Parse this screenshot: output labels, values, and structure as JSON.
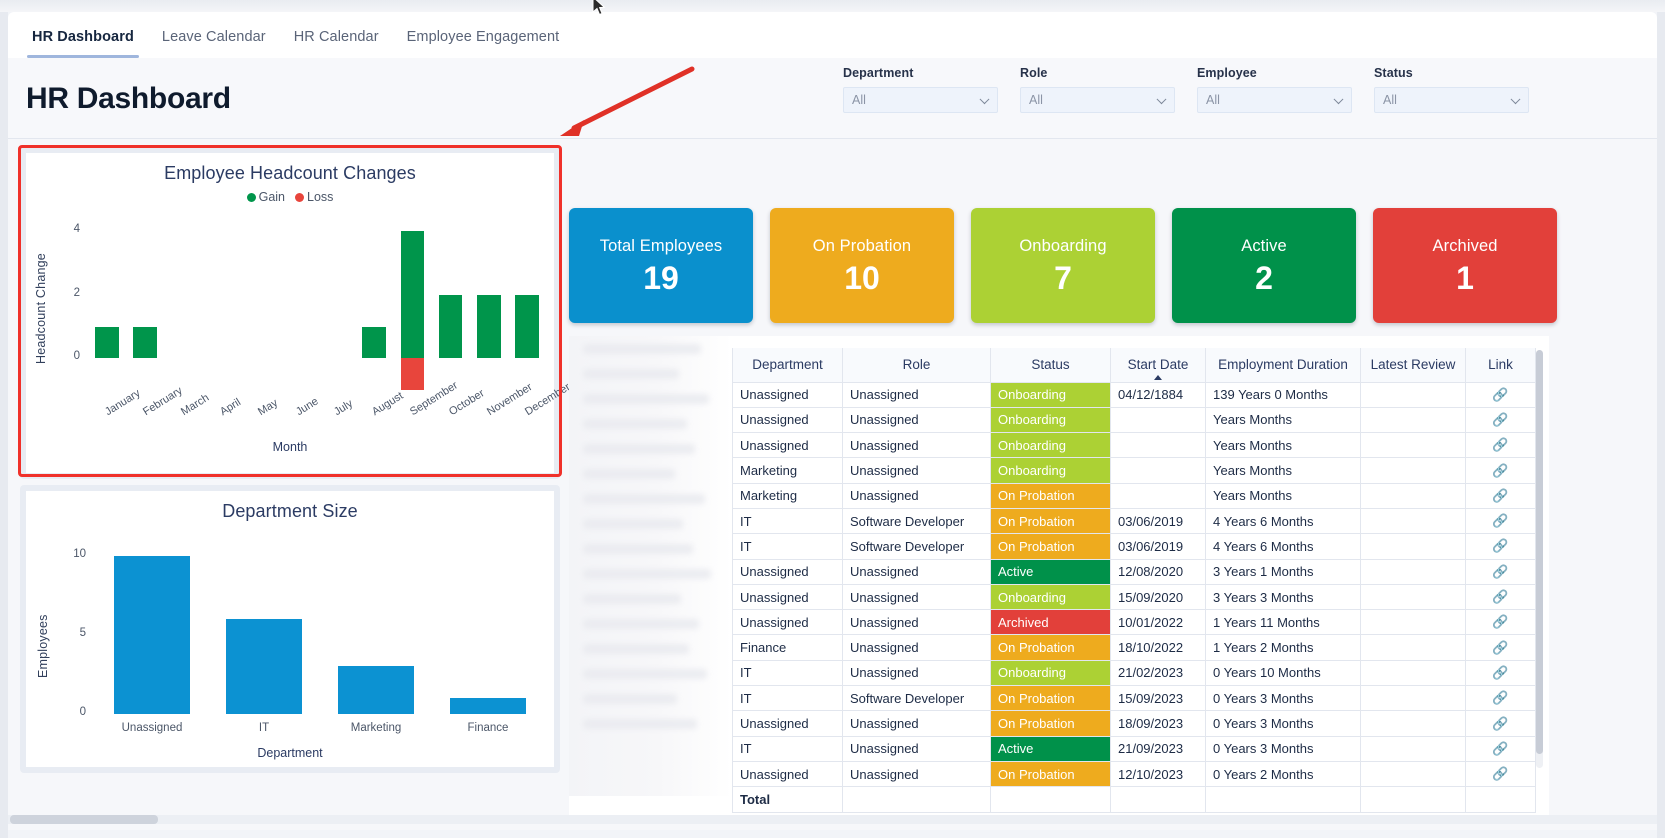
{
  "tabs": [
    {
      "label": "HR Dashboard",
      "active": true
    },
    {
      "label": "Leave Calendar",
      "active": false
    },
    {
      "label": "HR Calendar",
      "active": false
    },
    {
      "label": "Employee Engagement",
      "active": false
    }
  ],
  "header": {
    "title": "HR Dashboard"
  },
  "filters": [
    {
      "label": "Department",
      "value": "All"
    },
    {
      "label": "Role",
      "value": "All"
    },
    {
      "label": "Employee",
      "value": "All"
    },
    {
      "label": "Status",
      "value": "All"
    }
  ],
  "kpis": [
    {
      "label": "Total Employees",
      "value": "19",
      "color": "#0a90cd"
    },
    {
      "label": "On Probation",
      "value": "10",
      "color": "#eeab1e"
    },
    {
      "label": "Onboarding",
      "value": "7",
      "color": "#acd134"
    },
    {
      "label": "Active",
      "value": "2",
      "color": "#00914a"
    },
    {
      "label": "Archived",
      "value": "1",
      "color": "#e2403a"
    }
  ],
  "chart_data": [
    {
      "type": "bar",
      "title": "Employee Headcount Changes",
      "xlabel": "Month",
      "ylabel": "Headcount Change",
      "categories": [
        "January",
        "February",
        "March",
        "April",
        "May",
        "June",
        "July",
        "August",
        "September",
        "October",
        "November",
        "December"
      ],
      "series": [
        {
          "name": "Gain",
          "color": "#00954b",
          "values": [
            1,
            1,
            0,
            0,
            0,
            0,
            0,
            1,
            4,
            2,
            2,
            2
          ]
        },
        {
          "name": "Loss",
          "color": "#e8453c",
          "values": [
            0,
            0,
            0,
            0,
            0,
            0,
            0,
            0,
            -1,
            0,
            0,
            0
          ]
        }
      ],
      "yticks": [
        0,
        2,
        4
      ],
      "ylim": [
        -1.3,
        4.4
      ],
      "grid": false,
      "legend_position": "top"
    },
    {
      "type": "bar",
      "title": "Department Size",
      "xlabel": "Department",
      "ylabel": "Employees",
      "categories": [
        "Unassigned",
        "IT",
        "Marketing",
        "Finance"
      ],
      "values": [
        10,
        6,
        3,
        1
      ],
      "color": "#0c92d2",
      "yticks": [
        0,
        5,
        10
      ],
      "ylim": [
        0,
        10.6
      ],
      "grid": false,
      "legend_position": "none"
    }
  ],
  "table": {
    "columns": [
      "Department",
      "Role",
      "Status",
      "Start Date",
      "Employment Duration",
      "Latest Review",
      "Link"
    ],
    "sorted_column": "Start Date",
    "sort_direction": "ascending",
    "total_label": "Total",
    "link_icon": "chain-link-icon",
    "rows": [
      {
        "department": "Unassigned",
        "role": "Unassigned",
        "status": "Onboarding",
        "status_color": "#acd134",
        "start_date": "04/12/1884",
        "duration": "139 Years 0 Months",
        "review": "",
        "link": "🔗"
      },
      {
        "department": "Unassigned",
        "role": "Unassigned",
        "status": "Onboarding",
        "status_color": "#acd134",
        "start_date": "",
        "duration": "Years Months",
        "review": "",
        "link": "🔗"
      },
      {
        "department": "Unassigned",
        "role": "Unassigned",
        "status": "Onboarding",
        "status_color": "#acd134",
        "start_date": "",
        "duration": "Years Months",
        "review": "",
        "link": "🔗"
      },
      {
        "department": "Marketing",
        "role": "Unassigned",
        "status": "Onboarding",
        "status_color": "#acd134",
        "start_date": "",
        "duration": "Years Months",
        "review": "",
        "link": "🔗"
      },
      {
        "department": "Marketing",
        "role": "Unassigned",
        "status": "On Probation",
        "status_color": "#eeab1e",
        "start_date": "",
        "duration": "Years Months",
        "review": "",
        "link": "🔗"
      },
      {
        "department": "IT",
        "role": "Software Developer",
        "status": "On Probation",
        "status_color": "#eeab1e",
        "start_date": "03/06/2019",
        "duration": "4 Years 6 Months",
        "review": "",
        "link": "🔗"
      },
      {
        "department": "IT",
        "role": "Software Developer",
        "status": "On Probation",
        "status_color": "#eeab1e",
        "start_date": "03/06/2019",
        "duration": "4 Years 6 Months",
        "review": "",
        "link": "🔗"
      },
      {
        "department": "Unassigned",
        "role": "Unassigned",
        "status": "Active",
        "status_color": "#00914a",
        "start_date": "12/08/2020",
        "duration": "3 Years 1 Months",
        "review": "",
        "link": "🔗"
      },
      {
        "department": "Unassigned",
        "role": "Unassigned",
        "status": "Onboarding",
        "status_color": "#acd134",
        "start_date": "15/09/2020",
        "duration": "3 Years 3 Months",
        "review": "",
        "link": "🔗"
      },
      {
        "department": "Unassigned",
        "role": "Unassigned",
        "status": "Archived",
        "status_color": "#e2403a",
        "start_date": "10/01/2022",
        "duration": "1 Years 11 Months",
        "review": "",
        "link": "🔗"
      },
      {
        "department": "Finance",
        "role": "Unassigned",
        "status": "On Probation",
        "status_color": "#eeab1e",
        "start_date": "18/10/2022",
        "duration": "1 Years 2 Months",
        "review": "",
        "link": "🔗"
      },
      {
        "department": "IT",
        "role": "Unassigned",
        "status": "Onboarding",
        "status_color": "#acd134",
        "start_date": "21/02/2023",
        "duration": "0 Years 10 Months",
        "review": "",
        "link": "🔗"
      },
      {
        "department": "IT",
        "role": "Software Developer",
        "status": "On Probation",
        "status_color": "#eeab1e",
        "start_date": "15/09/2023",
        "duration": "0 Years 3 Months",
        "review": "",
        "link": "🔗"
      },
      {
        "department": "Unassigned",
        "role": "Unassigned",
        "status": "On Probation",
        "status_color": "#eeab1e",
        "start_date": "18/09/2023",
        "duration": "0 Years 3 Months",
        "review": "",
        "link": "🔗"
      },
      {
        "department": "IT",
        "role": "Unassigned",
        "status": "Active",
        "status_color": "#00914a",
        "start_date": "21/09/2023",
        "duration": "0 Years 3 Months",
        "review": "",
        "link": "🔗"
      },
      {
        "department": "Unassigned",
        "role": "Unassigned",
        "status": "On Probation",
        "status_color": "#eeab1e",
        "start_date": "12/10/2023",
        "duration": "0 Years 2 Months",
        "review": "",
        "link": "🔗"
      }
    ]
  },
  "annotation": {
    "type": "red-arrow",
    "color": "#e03127",
    "points_to": "Employee Headcount Changes"
  }
}
